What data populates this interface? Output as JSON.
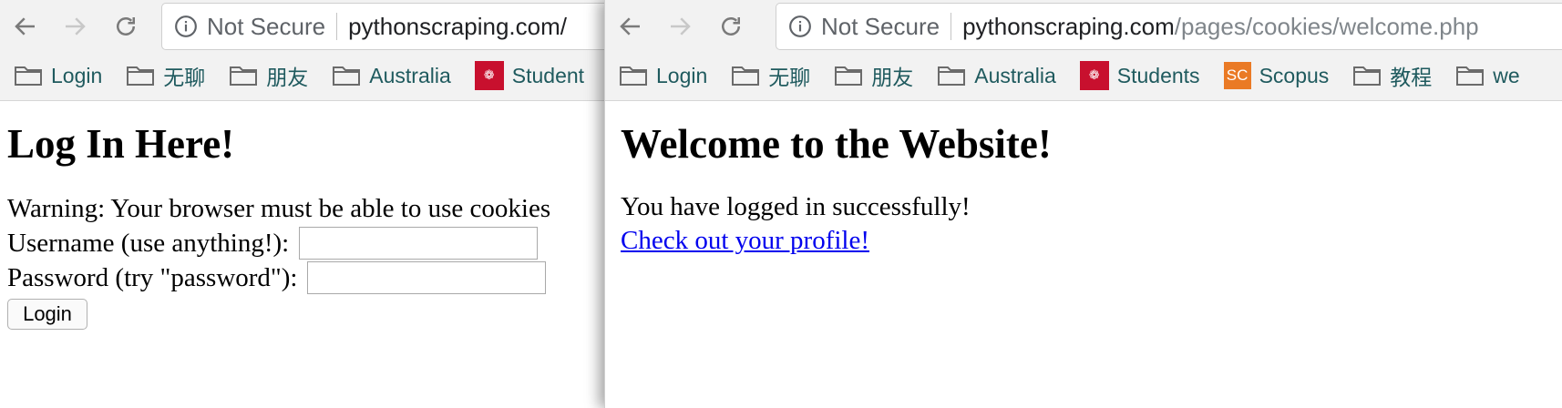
{
  "left_window": {
    "secure_label": "Not Secure",
    "url_host": "pythonscraping.com/",
    "url_path": "",
    "bookmarks": [
      {
        "label": "Login",
        "icon": "folder-icon"
      },
      {
        "label": "无聊",
        "icon": "folder-icon"
      },
      {
        "label": "朋友",
        "icon": "folder-icon"
      },
      {
        "label": "Australia",
        "icon": "folder-icon"
      },
      {
        "label": "Student",
        "icon": "students-favicon"
      }
    ],
    "page": {
      "heading": "Log In Here!",
      "warning": "Warning: Your browser must be able to use cookies",
      "username_label": "Username (use anything!):",
      "username_value": "",
      "password_label": "Password (try \"password\"):",
      "password_value": "",
      "login_button": "Login"
    }
  },
  "right_window": {
    "secure_label": "Not Secure",
    "url_host": "pythonscraping.com",
    "url_path": "/pages/cookies/welcome.php",
    "bookmarks": [
      {
        "label": "Login",
        "icon": "folder-icon"
      },
      {
        "label": "无聊",
        "icon": "folder-icon"
      },
      {
        "label": "朋友",
        "icon": "folder-icon"
      },
      {
        "label": "Australia",
        "icon": "folder-icon"
      },
      {
        "label": "Students",
        "icon": "students-favicon"
      },
      {
        "label": "Scopus",
        "icon": "scopus-favicon",
        "icon_text": "SC"
      },
      {
        "label": "教程",
        "icon": "folder-icon"
      },
      {
        "label": "we",
        "icon": "folder-icon"
      }
    ],
    "page": {
      "heading": "Welcome to the Website!",
      "message": "You have logged in successfully!",
      "profile_link": "Check out your profile!"
    }
  },
  "colors": {
    "chrome_bg": "#f2f2f2",
    "bookmark_text": "#1f5a5e",
    "link": "#0000ee",
    "students_icon": "#c8102e",
    "scopus_icon": "#ea7a25"
  }
}
